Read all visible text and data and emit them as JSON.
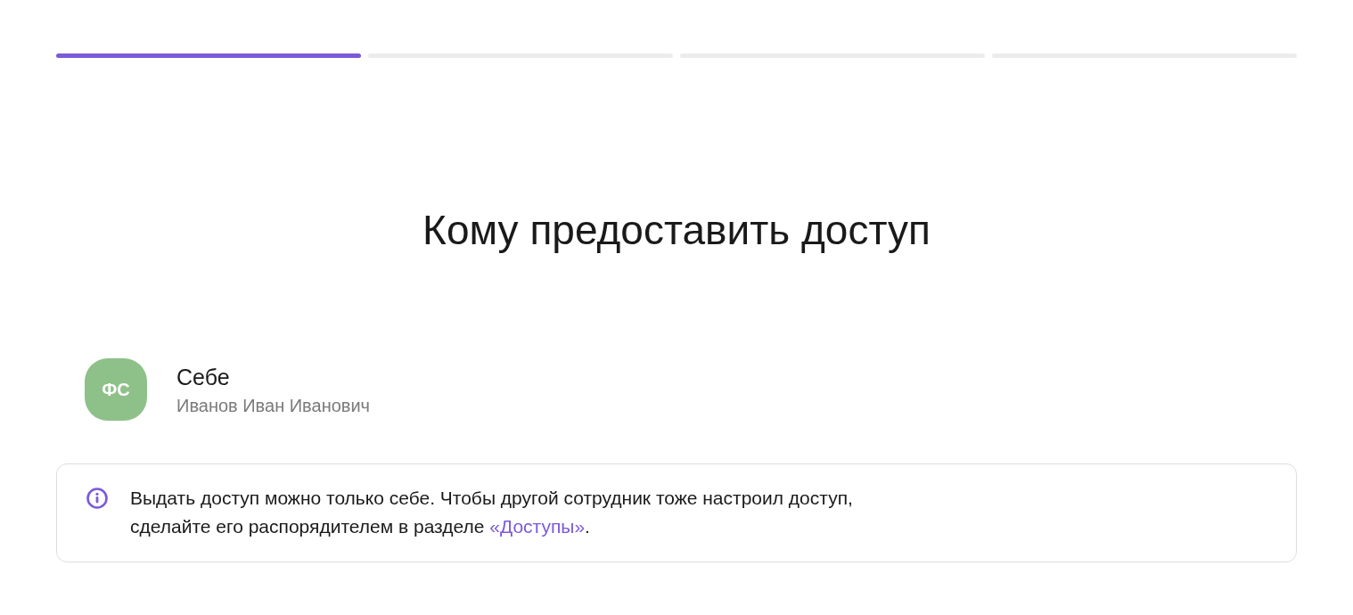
{
  "progress_steps": [
    {
      "done": true
    },
    {
      "done": false
    },
    {
      "done": false
    },
    {
      "done": false
    }
  ],
  "title": "Кому предоставить доступ",
  "recipients": [
    {
      "initials": "ФС",
      "color": "#8dc189",
      "label": "Себе",
      "name": "Иванов Иван Иванович"
    }
  ],
  "info_notice": {
    "text": "Выдать доступ можно только себе. Чтобы другой сотрудник тоже настроил доступ, сделайте его распорядителем в разделе ",
    "link": "«Доступы»",
    "text_after": "."
  }
}
